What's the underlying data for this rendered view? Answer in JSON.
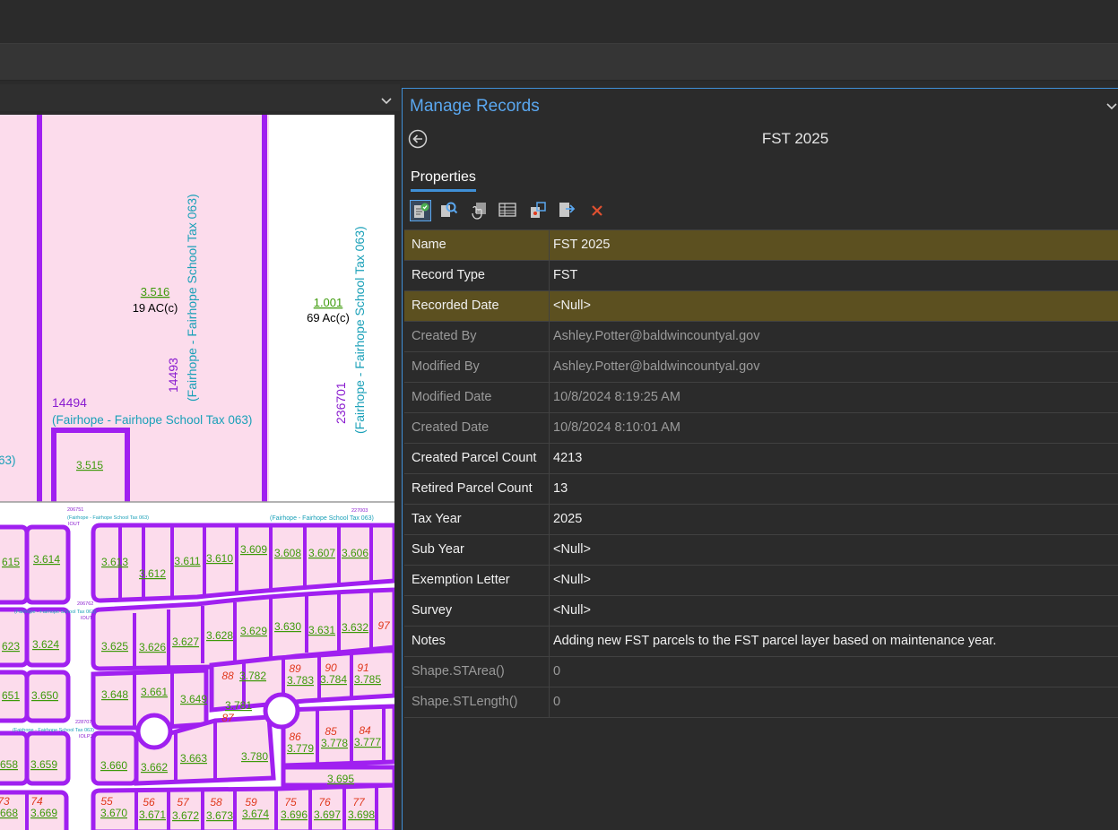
{
  "panel": {
    "title": "Manage Records",
    "record_name": "FST 2025",
    "properties_tab": "Properties",
    "tools": [
      "validate-icon",
      "find-parcels-icon",
      "select-parcels-icon",
      "attributes-table-icon",
      "record-map-icon",
      "record-export-icon",
      "delete-icon"
    ],
    "rows": [
      {
        "label": "Name",
        "value": "FST 2025",
        "highlight": true,
        "readonly": false
      },
      {
        "label": "Record Type",
        "value": "FST",
        "highlight": false,
        "readonly": false
      },
      {
        "label": "Recorded Date",
        "value": "<Null>",
        "highlight": true,
        "readonly": false
      },
      {
        "label": "Created By",
        "value": "Ashley.Potter@baldwincountyal.gov",
        "highlight": false,
        "readonly": true
      },
      {
        "label": "Modified By",
        "value": "Ashley.Potter@baldwincountyal.gov",
        "highlight": false,
        "readonly": true
      },
      {
        "label": "Modified Date",
        "value": "10/8/2024 8:19:25 AM",
        "highlight": false,
        "readonly": true
      },
      {
        "label": "Created Date",
        "value": "10/8/2024 8:10:01 AM",
        "highlight": false,
        "readonly": true
      },
      {
        "label": "Created Parcel Count",
        "value": "4213",
        "highlight": false,
        "readonly": false
      },
      {
        "label": "Retired Parcel Count",
        "value": "13",
        "highlight": false,
        "readonly": false
      },
      {
        "label": "Tax Year",
        "value": "2025",
        "highlight": false,
        "readonly": false
      },
      {
        "label": "Sub Year",
        "value": "<Null>",
        "highlight": false,
        "readonly": false
      },
      {
        "label": "Exemption Letter",
        "value": "<Null>",
        "highlight": false,
        "readonly": false
      },
      {
        "label": "Survey",
        "value": "<Null>",
        "highlight": false,
        "readonly": false
      },
      {
        "label": "Notes",
        "value": "Adding new FST parcels to the FST parcel layer based on maintenance year.",
        "highlight": false,
        "readonly": false
      },
      {
        "label": "Shape.STArea()",
        "value": "0",
        "highlight": false,
        "readonly": true
      },
      {
        "label": "Shape.STLength()",
        "value": "0",
        "highlight": false,
        "readonly": true
      }
    ]
  },
  "map": {
    "colors": {
      "parcel_fill": "#fcdcec",
      "parcel_line": "#a020f0",
      "label_green": "#3d9a0a",
      "label_red": "#e0381c",
      "label_cyan": "#1aa0b8",
      "label_purple": "#8a1ccf"
    },
    "parcels_top": [
      {
        "id": "3.516",
        "acres": "19 AC(c)"
      },
      {
        "id": "1.001",
        "acres": "69 Ac(c)"
      },
      {
        "id": "3.515"
      }
    ],
    "tax_district": "(Fairhope - Fairhope School Tax 063)",
    "tax_district_short": "(Fairhope - Fairhope School Tax 063)",
    "tax_fragment": "63)",
    "pins": [
      "14494",
      "14493",
      "236701"
    ],
    "small_pins": [
      "206751",
      "227003",
      "206762",
      "228707"
    ],
    "small_tags": [
      "IOUT",
      "IOUT",
      "IOLP3"
    ],
    "row1": [
      "615",
      "3.614",
      "3.613",
      "3.612",
      "3.611",
      "3.610",
      "3.609",
      "3.608",
      "3.607",
      "3.606"
    ],
    "row2": [
      "623",
      "3.624",
      "3.625",
      "3.626",
      "3.627",
      "3.628",
      "3.629",
      "3.630",
      "3.631",
      "3.632"
    ],
    "row2_red": [
      "97"
    ],
    "row3": [
      "651",
      "3.650",
      "3.648",
      "3.661",
      "3.649",
      "3.782",
      "3.783",
      "3.784",
      "3.785",
      "3.781"
    ],
    "row3_red": [
      "88",
      "89",
      "90",
      "91",
      "87"
    ],
    "row4": [
      "658",
      "3.659",
      "3.660",
      "3.662",
      "3.663",
      "3.780",
      "3.779",
      "3.778",
      "3.777"
    ],
    "row4_red": [
      "86",
      "85",
      "84"
    ],
    "row5": [
      "668",
      "3.669",
      "3.670",
      "3.671",
      "3.672",
      "3.673",
      "3.674",
      "3.696",
      "3.697",
      "3.698",
      "3.695"
    ],
    "row5_red": [
      "73",
      "74",
      "55",
      "56",
      "57",
      "58",
      "59",
      "75",
      "76",
      "77"
    ]
  }
}
